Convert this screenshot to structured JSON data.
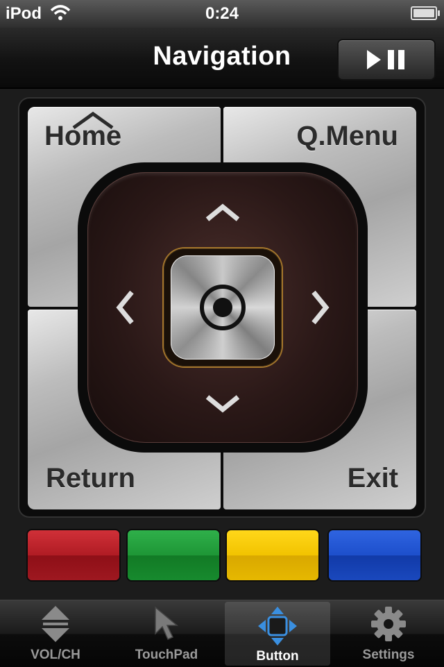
{
  "status_bar": {
    "carrier": "iPod",
    "time": "0:24"
  },
  "nav": {
    "title": "Navigation",
    "play_pause_icon": "play-pause-icon"
  },
  "remote": {
    "home_label": "Home",
    "qmenu_label": "Q.Menu",
    "return_label": "Return",
    "exit_label": "Exit",
    "ok_icon": "target-icon",
    "accent_color": "#a3752b"
  },
  "color_buttons": [
    {
      "name": "red",
      "color": "#b01c24"
    },
    {
      "name": "green",
      "color": "#1e9636"
    },
    {
      "name": "yellow",
      "color": "#f2c300"
    },
    {
      "name": "blue",
      "color": "#1d4fcc"
    }
  ],
  "tabs": [
    {
      "label": "VOL/CH",
      "icon": "up-down-icon",
      "selected": false
    },
    {
      "label": "TouchPad",
      "icon": "pointer-icon",
      "selected": false
    },
    {
      "label": "Button",
      "icon": "dpad-icon",
      "selected": true
    },
    {
      "label": "Settings",
      "icon": "gear-icon",
      "selected": false
    }
  ]
}
